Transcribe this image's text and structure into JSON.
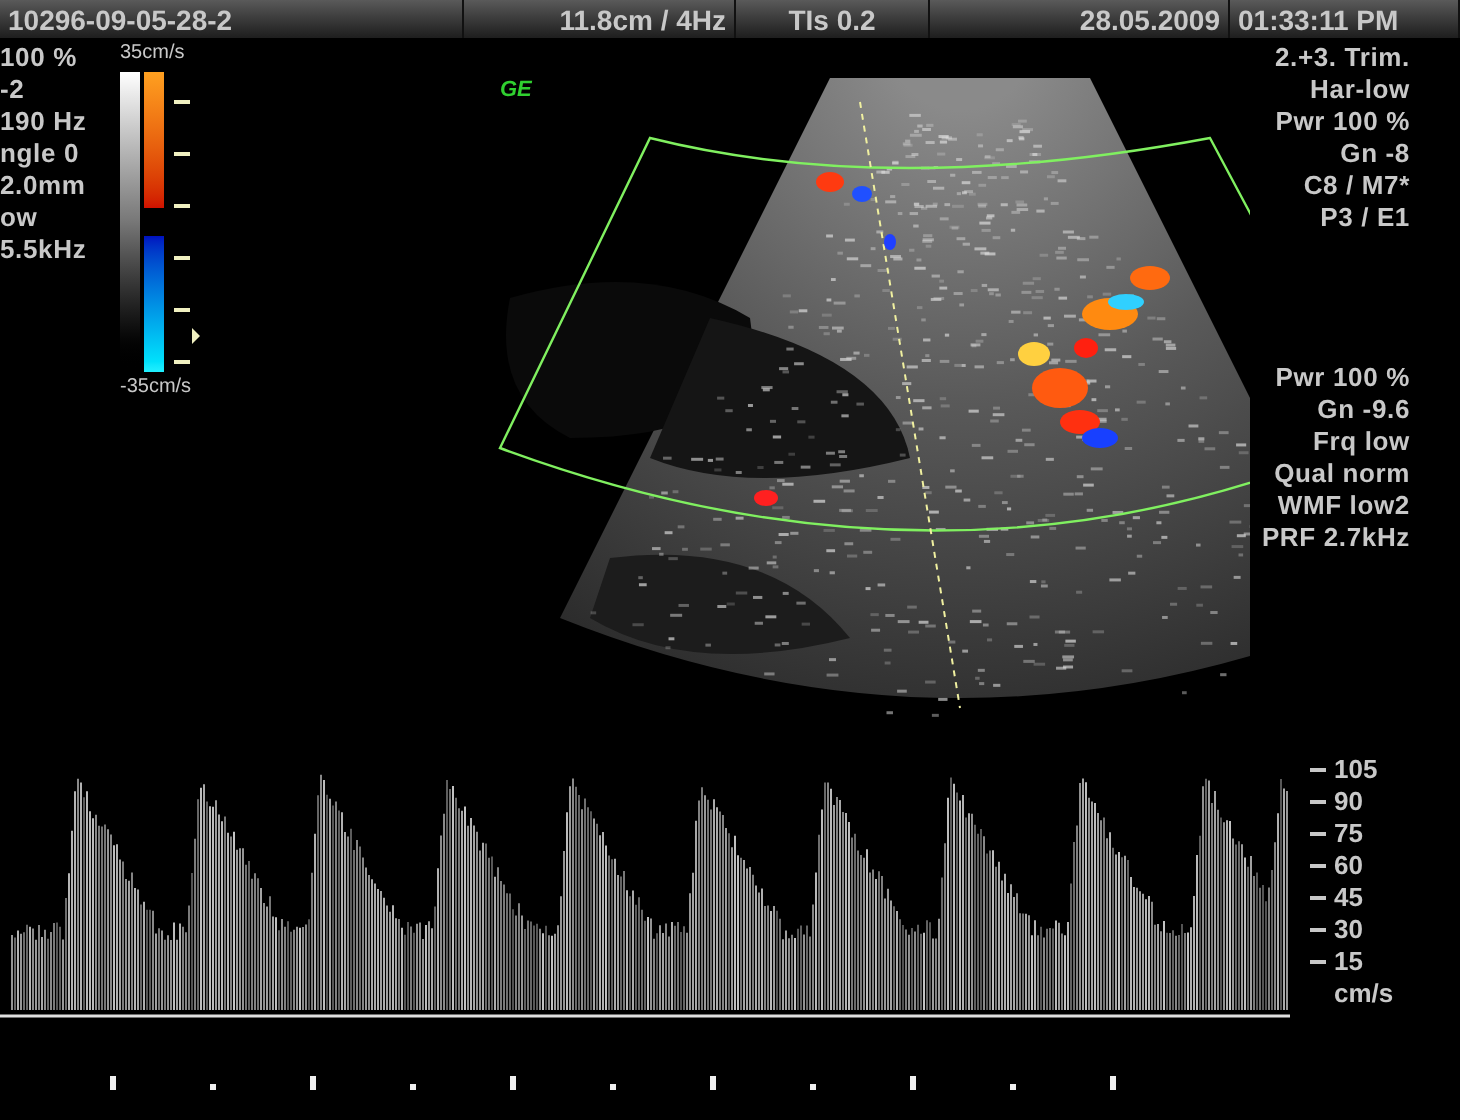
{
  "header": {
    "cells": [
      "10296-09-05-28-2",
      "11.8cm / 4Hz",
      "TIs 0.2",
      "28.05.2009",
      "01:33:11 PM"
    ]
  },
  "left_params": [
    "100 %",
    "-2",
    "190 Hz",
    "ngle 0",
    "2.0mm",
    "ow",
    "5.5kHz"
  ],
  "color_scale": {
    "top": "35cm/s",
    "bottom": "-35cm/s"
  },
  "logo": "GE",
  "right_params_top": [
    "2.+3. Trim.",
    "Har-low",
    "Pwr 100 %",
    "Gn -8",
    "C8 / M7*",
    "P3 / E1"
  ],
  "right_params_bottom": [
    "Pwr 100 %",
    "Gn -9.6",
    "Frq low",
    "Qual norm",
    "WMF low2",
    "PRF 2.7kHz"
  ],
  "spectrum": {
    "scale": [
      "105",
      "90",
      "75",
      "60",
      "45",
      "30",
      "15"
    ],
    "unit": "cm/s"
  }
}
